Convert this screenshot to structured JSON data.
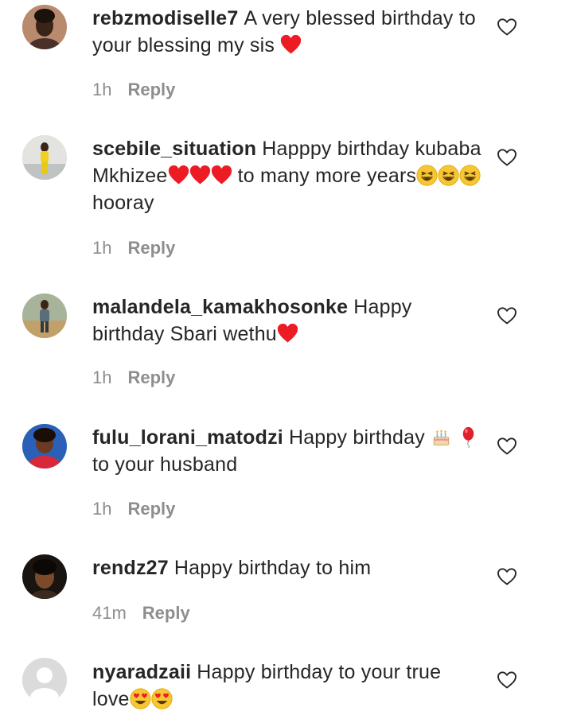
{
  "comments": [
    {
      "username": "rebzmodiselle7",
      "text": "A very blessed birthday to your blessing my sis",
      "time": "1h",
      "reply": "Reply"
    },
    {
      "username": "scebile_situation",
      "text_a": "Happpy birthday kubaba Mkhizee",
      "text_b": "to many more years",
      "text_c": "hooray",
      "time": "1h",
      "reply": "Reply"
    },
    {
      "username": "malandela_kamakhosonke",
      "text": "Happy birthday Sbari wethu",
      "time": "1h",
      "reply": "Reply"
    },
    {
      "username": "fulu_lorani_matodzi",
      "text_a": "Happy birthday",
      "text_b": "to your husband",
      "time": "1h",
      "reply": "Reply"
    },
    {
      "username": "rendz27",
      "text": "Happy birthday to him",
      "time": "41m",
      "reply": "Reply"
    },
    {
      "username": "nyaradzaii",
      "text_a": "Happy birthday to your true love",
      "time": "",
      "reply": ""
    }
  ],
  "icons": {
    "like": "heart-outline-icon",
    "heart": "red-heart-emoji",
    "laugh": "grinning-squinting-emoji",
    "cake": "birthday-cake-emoji",
    "balloon": "balloon-emoji",
    "heart_eyes": "heart-eyes-emoji"
  },
  "colors": {
    "text": "#262626",
    "meta": "#8e8e8e",
    "heart": "#ed1c24"
  }
}
